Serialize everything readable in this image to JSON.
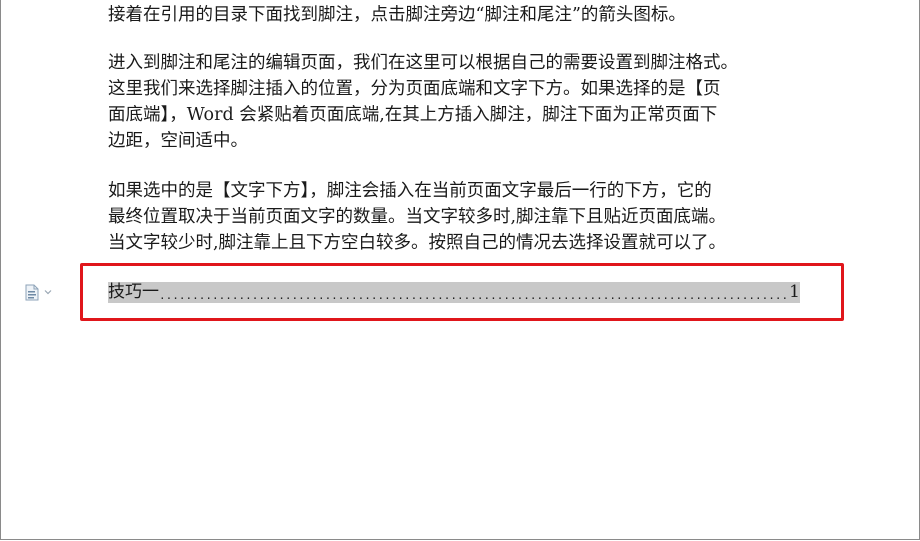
{
  "document": {
    "paragraphs": [
      {
        "lines": [
          "接着在引用的目录下面找到脚注，点击脚注旁边“脚注和尾注”的箭头图标。"
        ]
      },
      {
        "lines": [
          "进入到脚注和尾注的编辑页面，我们在这里可以根据自己的需要设置到脚注格式。",
          "这里我们来选择脚注插入的位置，分为页面底端和文字下方。如果选择的是【页",
          "面底端】，Word 会紧贴着页面底端,在其上方插入脚注，脚注下面为正常页面下",
          "边距，空间适中。"
        ]
      },
      {
        "lines": [
          "如果选中的是【文字下方】，脚注会插入在当前页面文字最后一行的下方，它的",
          "最终位置取决于当前页面文字的数量。当文字较多时,脚注靠下且贴近页面底端。",
          "当文字较少时,脚注靠上且下方空白较多。按照自己的情况去选择设置就可以了。"
        ]
      }
    ],
    "toc": {
      "entry_title": "技巧一",
      "leader": "..........................................................................................................................................................",
      "page_number": "1",
      "field_icon": "toc-field-icon",
      "dropdown_icon": "chevron-down-icon"
    },
    "highlight_color": "#e0161b",
    "field_shading_color": "#c8c8c8"
  }
}
